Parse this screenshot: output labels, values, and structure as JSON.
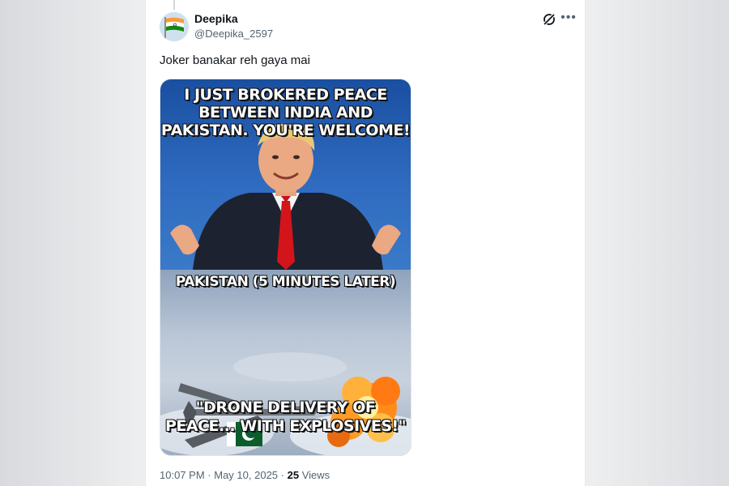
{
  "post": {
    "display_name": "Deepika",
    "handle": "@Deepika_2597",
    "text": "Joker banakar reh gaya mai",
    "time": "10:07 PM",
    "date": "May 10, 2025",
    "views_count": "25",
    "views_label": "Views",
    "separator": "·"
  },
  "media": {
    "top_caption": "I JUST BROKERED PEACE BETWEEN INDIA AND PAKISTAN. YOU'RE WELCOME!",
    "middle_caption": "PAKISTAN (5 MINUTES LATER)",
    "bottom_caption": "\"DRONE DELIVERY OF PEACE... WITH EXPLOSIVES!\""
  },
  "icons": {
    "grok": "grok-icon",
    "more": "more-icon"
  },
  "colors": {
    "text_primary": "#0f1419",
    "text_secondary": "#536471",
    "meme_sky": "#2f6bc0"
  }
}
